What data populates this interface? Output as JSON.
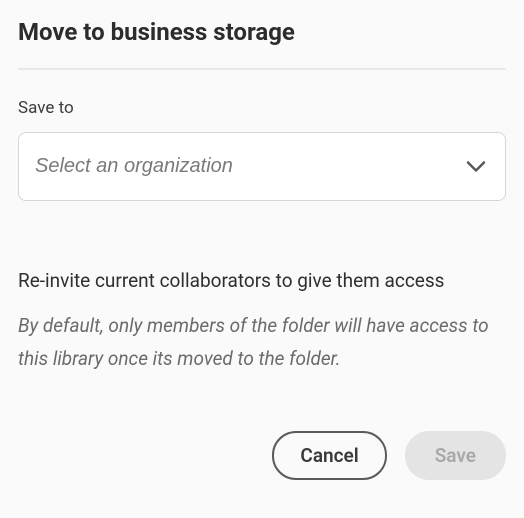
{
  "dialog": {
    "title": "Move to business storage"
  },
  "form": {
    "save_to_label": "Save to",
    "org_select_placeholder": "Select an organization"
  },
  "reinvite": {
    "heading": "Re-invite current collaborators to give them access",
    "description": "By default, only members of the folder will have access to this library once its moved to the folder."
  },
  "buttons": {
    "cancel": "Cancel",
    "save": "Save"
  }
}
